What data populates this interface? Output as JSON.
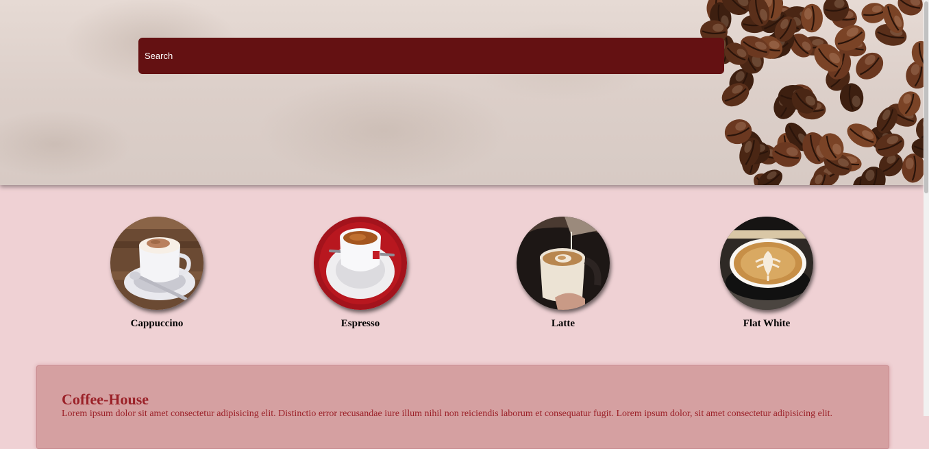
{
  "header": {
    "search_label": "Search"
  },
  "drinks": [
    {
      "label": "Cappuccino",
      "image": "cappuccino-image"
    },
    {
      "label": "Espresso",
      "image": "espresso-image"
    },
    {
      "label": "Latte",
      "image": "latte-image"
    },
    {
      "label": "Flat White",
      "image": "flat-white-image"
    }
  ],
  "about": {
    "title": "Coffee-House",
    "text": "Lorem ipsum dolor sit amet consectetur adipisicing elit. Distinctio error recusandae iure illum nihil non reiciendis laborum et consequatur fugit. Lorem ipsum dolor, sit amet consectetur adipisicing elit."
  },
  "colors": {
    "page_background": "#efd1d4",
    "search_background": "#641112",
    "card_background": "#d5a0a1",
    "accent_text": "#9b2128"
  }
}
